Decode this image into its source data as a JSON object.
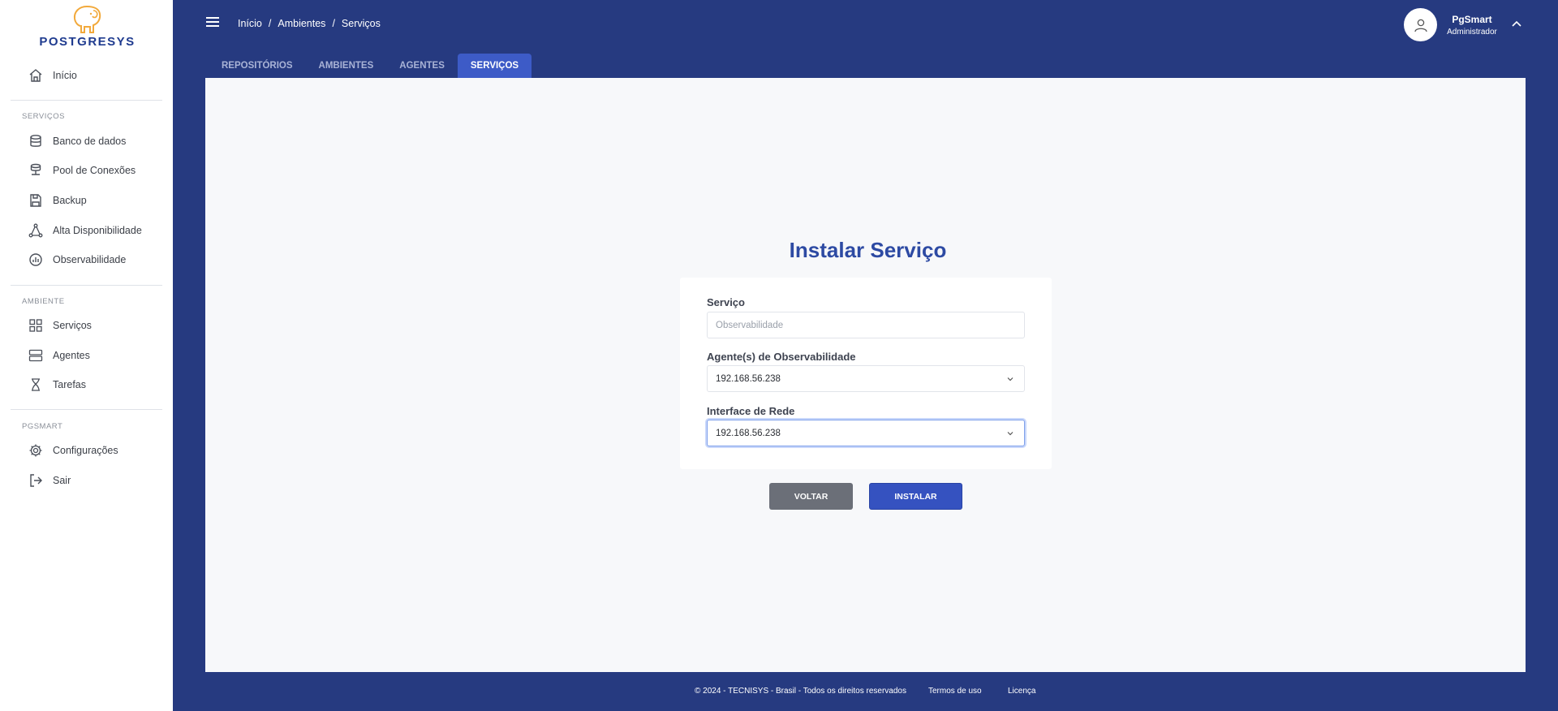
{
  "brand": {
    "logo_text": "POSTGRESYS",
    "logo_color": "#f2a93b"
  },
  "colors": {
    "header_bg": "#263a80",
    "accent": "#3552c0",
    "title": "#2d4aa3"
  },
  "sidebar": {
    "home": {
      "label": "Início",
      "icon": "home-icon"
    },
    "sections": [
      {
        "title": "SERVIÇOS",
        "items": [
          {
            "label": "Banco de dados",
            "icon": "database-icon"
          },
          {
            "label": "Pool de Conexões",
            "icon": "connection-pool-icon"
          },
          {
            "label": "Backup",
            "icon": "save-icon"
          },
          {
            "label": "Alta Disponibilidade",
            "icon": "network-triangle-icon"
          },
          {
            "label": "Observabilidade",
            "icon": "chart-pie-icon"
          }
        ]
      },
      {
        "title": "AMBIENTE",
        "items": [
          {
            "label": "Serviços",
            "icon": "grid-icon"
          },
          {
            "label": "Agentes",
            "icon": "server-icon"
          },
          {
            "label": "Tarefas",
            "icon": "hourglass-icon"
          }
        ]
      },
      {
        "title": "PGSMART",
        "items": [
          {
            "label": "Configurações",
            "icon": "gear-icon"
          },
          {
            "label": "Sair",
            "icon": "logout-icon"
          }
        ]
      }
    ]
  },
  "header": {
    "breadcrumb": [
      "Início",
      "/",
      "Ambientes",
      "/",
      "Serviços"
    ],
    "user": {
      "name": "PgSmart",
      "role": "Administrador"
    }
  },
  "tabs": [
    {
      "label": "REPOSITÓRIOS",
      "active": false
    },
    {
      "label": "AMBIENTES",
      "active": false
    },
    {
      "label": "AGENTES",
      "active": false
    },
    {
      "label": "SERVIÇOS",
      "active": true
    }
  ],
  "form": {
    "title": "Instalar Serviço",
    "service": {
      "label": "Serviço",
      "placeholder": "Observabilidade"
    },
    "agents": {
      "label": "Agente(s) de Observabilidade",
      "value": "192.168.56.238"
    },
    "interface": {
      "label": "Interface de Rede",
      "value": "192.168.56.238"
    },
    "back_label": "VOLTAR",
    "install_label": "INSTALAR"
  },
  "footer": {
    "copyright": "© 2024 - TECNISYS - Brasil - Todos os direitos reservados",
    "terms": "Termos de uso",
    "license": "Licença"
  }
}
